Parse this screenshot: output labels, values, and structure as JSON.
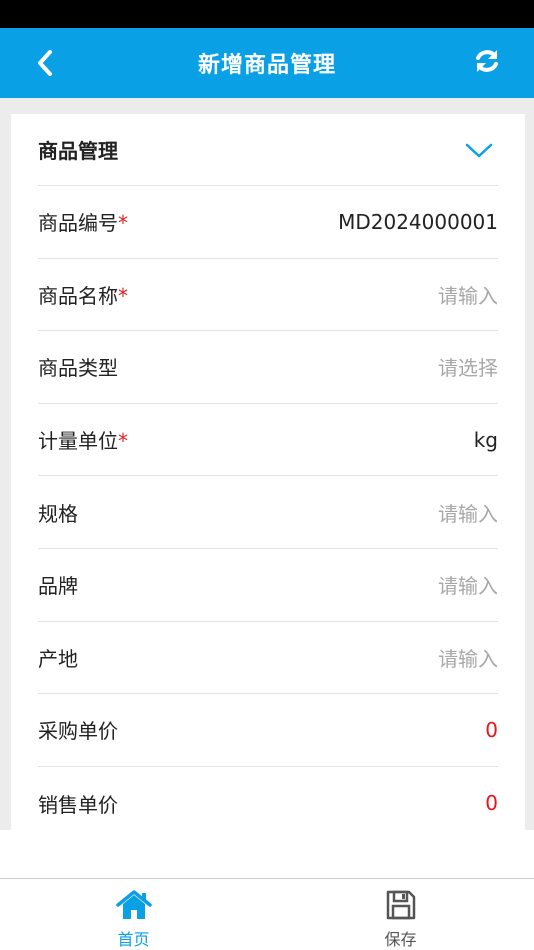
{
  "header": {
    "title": "新增商品管理",
    "back_icon": "chevron-left-icon",
    "refresh_icon": "refresh-icon"
  },
  "section": {
    "title": "商品管理",
    "toggle_icon": "chevron-down-icon"
  },
  "form": {
    "rows": [
      {
        "label": "商品编号",
        "required": "*",
        "value": "MD2024000001"
      },
      {
        "label": "商品名称",
        "required": "*",
        "placeholder": "请输入"
      },
      {
        "label": "商品类型",
        "required": "",
        "placeholder": "请选择"
      },
      {
        "label": "计量单位",
        "required": "*",
        "value": "kg"
      },
      {
        "label": "规格",
        "required": "",
        "placeholder": "请输入"
      },
      {
        "label": "品牌",
        "required": "",
        "placeholder": "请输入"
      },
      {
        "label": "产地",
        "required": "",
        "placeholder": "请输入"
      },
      {
        "label": "采购单价",
        "required": "",
        "value": "0"
      },
      {
        "label": "销售单价",
        "required": "",
        "value": "0"
      }
    ]
  },
  "tabbar": {
    "home_label": "首页",
    "save_label": "保存"
  },
  "colors": {
    "accent": "#0aa0e6",
    "required": "#e02020",
    "price": "#e8141c",
    "placeholder": "#a8a8a8"
  }
}
